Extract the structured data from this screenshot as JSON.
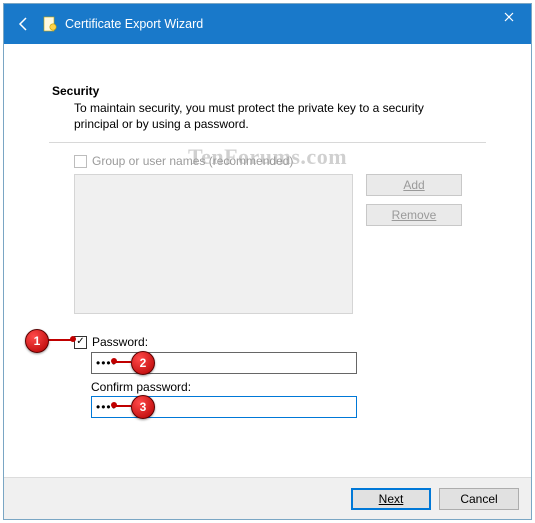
{
  "window": {
    "title": "Certificate Export Wizard"
  },
  "security": {
    "heading": "Security",
    "description": "To maintain security, you must protect the private key to a security principal or by using a password.",
    "group_checkbox_label": "Group or user names (recommended)",
    "group_checkbox_checked": false,
    "add_button": "Add",
    "remove_button": "Remove",
    "password_checkbox_label": "Password:",
    "password_checkbox_checked": true,
    "password_value": "••••",
    "confirm_label": "Confirm password:",
    "confirm_value": "••••"
  },
  "footer": {
    "next": "Next",
    "cancel": "Cancel"
  },
  "watermark": "TenForums.com",
  "annotations": {
    "b1": "1",
    "b2": "2",
    "b3": "3"
  }
}
